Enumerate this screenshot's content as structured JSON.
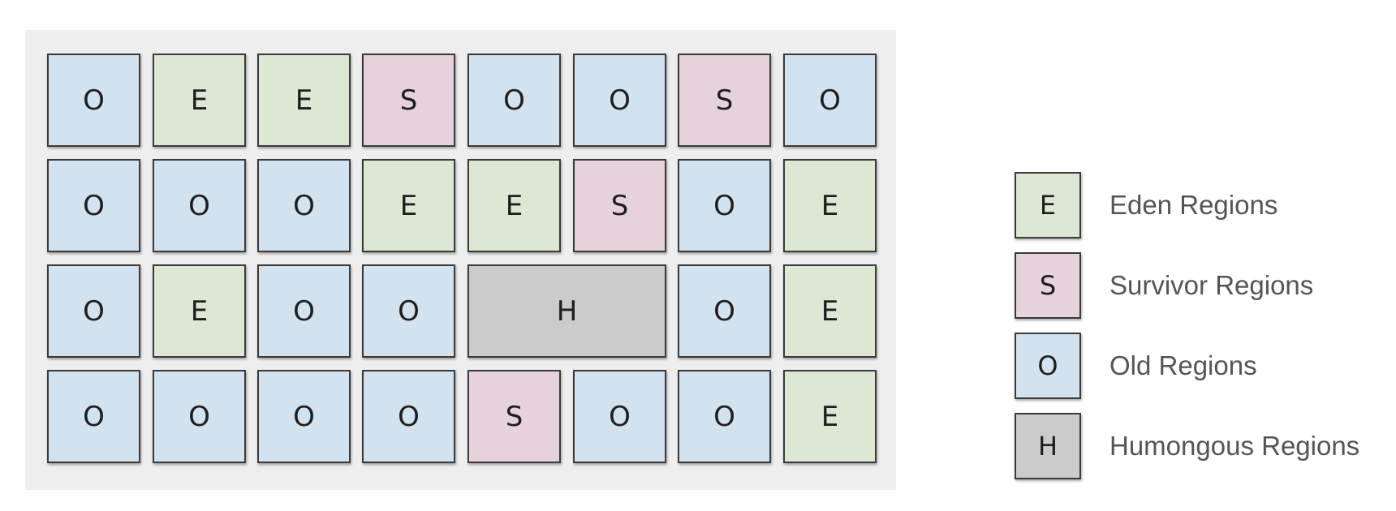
{
  "heap": {
    "rows": [
      [
        "O",
        "E",
        "E",
        "S",
        "O",
        "O",
        "S",
        "O"
      ],
      [
        "O",
        "O",
        "O",
        "E",
        "E",
        "S",
        "O",
        "E"
      ],
      [
        "O",
        "E",
        "O",
        "O",
        "H",
        "H",
        "O",
        "E"
      ],
      [
        "O",
        "O",
        "O",
        "O",
        "S",
        "O",
        "O",
        "E"
      ]
    ]
  },
  "region_colors": {
    "E": "#dce8d4",
    "S": "#e6d2dc",
    "O": "#d3e2ef",
    "H": "#cbcbcb"
  },
  "legend": [
    {
      "letter": "E",
      "label": "Eden Regions"
    },
    {
      "letter": "S",
      "label": "Survivor Regions"
    },
    {
      "letter": "O",
      "label": "Old Regions"
    },
    {
      "letter": "H",
      "label": "Humongous Regions"
    }
  ]
}
